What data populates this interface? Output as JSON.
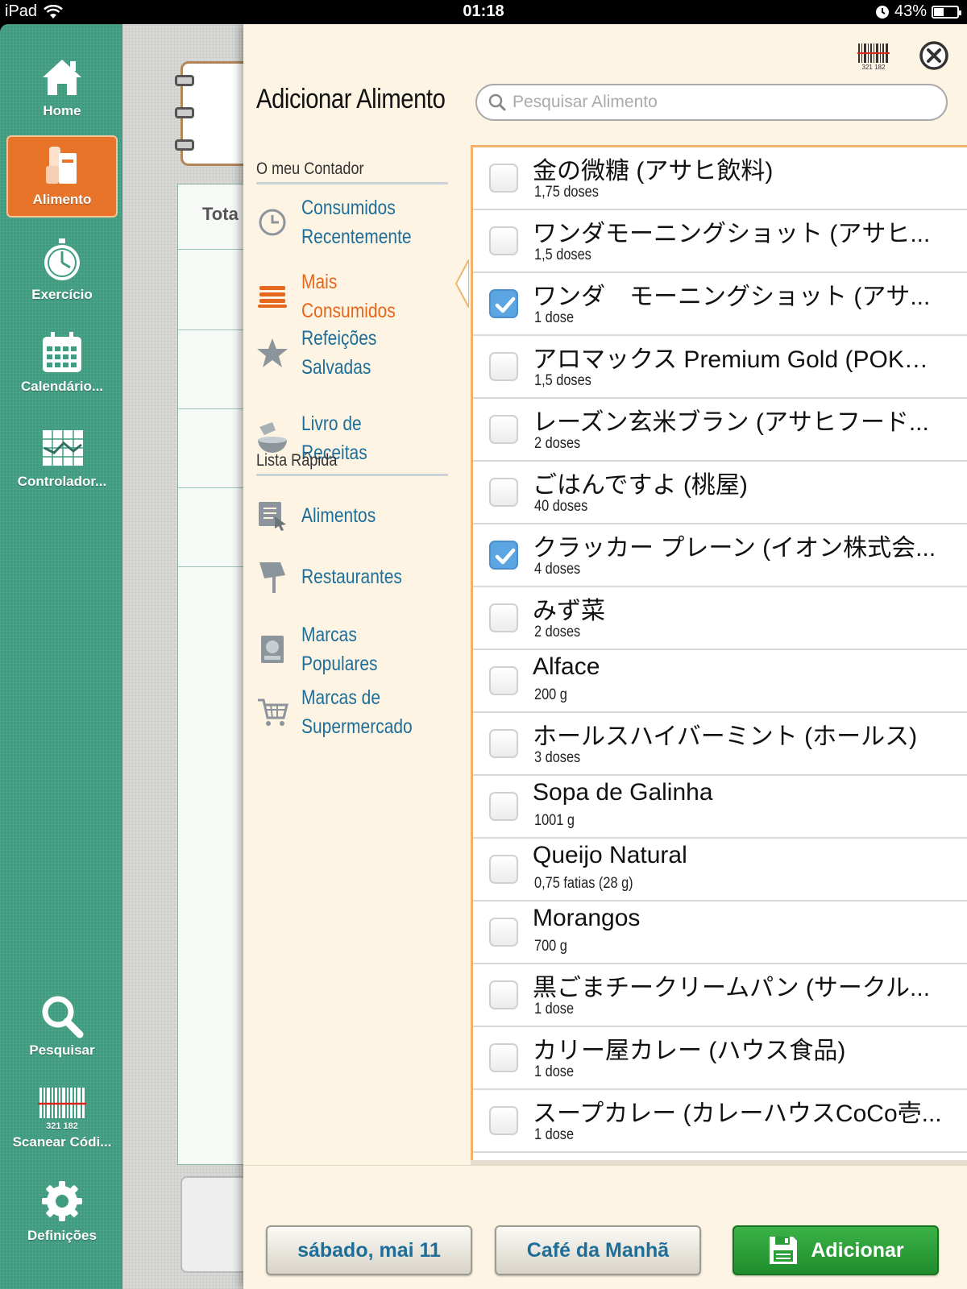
{
  "status_bar": {
    "device": "iPad",
    "time": "01:18",
    "battery": "43%",
    "battery_level": 0.43
  },
  "sidebar": {
    "items": [
      {
        "label": "Home",
        "icon": "home-icon"
      },
      {
        "label": "Alimento",
        "icon": "food-icon",
        "active": true
      },
      {
        "label": "Exercício",
        "icon": "stopwatch-icon"
      },
      {
        "label": "Calendário...",
        "icon": "calendar-icon"
      },
      {
        "label": "Controlador...",
        "icon": "chart-icon"
      },
      {
        "label": "Pesquisar",
        "icon": "search-icon"
      },
      {
        "label": "Scanear Códi...",
        "icon": "barcode-icon"
      },
      {
        "label": "Definições",
        "icon": "gear-icon"
      }
    ],
    "barcode_digits": "321 182"
  },
  "background_page": {
    "table_header": "Tota"
  },
  "panel": {
    "title": "Adicionar Alimento",
    "search_placeholder": "Pesquisar Alimento",
    "barcode_digits": "321 182",
    "sections": {
      "my_counter": "O meu Contador",
      "quick_list": "Lista Rápida"
    },
    "menu": {
      "recent": "Consumidos\nRecentemente",
      "most": "Mais Consumidos",
      "saved_meals": "Refeições\nSalvadas",
      "recipes": "Livro de Receitas",
      "foods": "Alimentos",
      "restaurants": "Restaurantes",
      "popular_brands": "Marcas Populares",
      "supermarket_brands": "Marcas de\nSupermercado"
    }
  },
  "foods": [
    {
      "name": "金の微糖 (アサヒ飲料)",
      "amount": "1,75 doses",
      "checked": false
    },
    {
      "name": "ワンダモーニングショット (アサヒ...",
      "amount": "1,5 doses",
      "checked": false
    },
    {
      "name": "ワンダ　モーニングショット (アサ...",
      "amount": "1 dose",
      "checked": true
    },
    {
      "name": "アロマックス Premium Gold (POKKA)",
      "amount": "1,5 doses",
      "checked": false
    },
    {
      "name": "レーズン玄米ブラン (アサヒフード...",
      "amount": "2 doses",
      "checked": false
    },
    {
      "name": "ごはんですよ (桃屋)",
      "amount": "40 doses",
      "checked": false
    },
    {
      "name": "クラッカー プレーン (イオン株式会...",
      "amount": "4 doses",
      "checked": true
    },
    {
      "name": "みず菜",
      "amount": "2 doses",
      "checked": false
    },
    {
      "name": "Alface",
      "amount": "200 g",
      "checked": false
    },
    {
      "name": "ホールスハイバーミント (ホールス)",
      "amount": "3 doses",
      "checked": false
    },
    {
      "name": "Sopa de Galinha",
      "amount": "1001 g",
      "checked": false
    },
    {
      "name": "Queijo Natural",
      "amount": "0,75 fatias (28 g)",
      "checked": false
    },
    {
      "name": "Morangos",
      "amount": "700 g",
      "checked": false
    },
    {
      "name": "黒ごまチークリームパン (サークル...",
      "amount": "1 dose",
      "checked": false
    },
    {
      "name": "カリー屋カレー (ハウス食品)",
      "amount": "1 dose",
      "checked": false
    },
    {
      "name": "スープカレー (カレーハウスCoCo壱...",
      "amount": "1 dose",
      "checked": false
    }
  ],
  "footer": {
    "date": "sábado, mai 11",
    "meal": "Café da Manhã",
    "add": "Adicionar"
  },
  "colors": {
    "sidebar_green": "#3f9c80",
    "active_orange": "#e8742a",
    "link_blue": "#1e6e9a",
    "selected_orange": "#e5671d",
    "add_green": "#2a9e37",
    "panel_cream": "#fdf4e3"
  }
}
